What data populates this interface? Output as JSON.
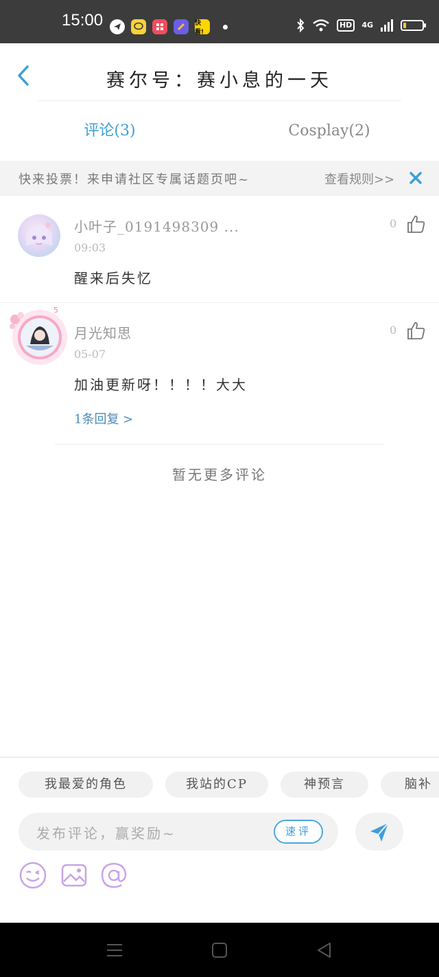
{
  "status_bar": {
    "time": "15:00",
    "app_icons": [
      {
        "name": "messenger-app-icon",
        "color": "#ffffff",
        "label": ""
      },
      {
        "name": "chat-app-icon",
        "color": "#f7d23c",
        "label": ""
      },
      {
        "name": "media-app-icon",
        "color": "#ef4e5e",
        "label": ""
      },
      {
        "name": "notes-app-icon",
        "color": "#6a5fe3",
        "label": ""
      },
      {
        "name": "kuaikan-app-icon",
        "color": "#ffd600",
        "label": "快看!"
      }
    ],
    "hd_label": "HD",
    "network_label": "4G",
    "battery_level": 0.15
  },
  "header": {
    "title": "赛尔号：赛小息的一天"
  },
  "tabs": [
    {
      "label": "评论(3)",
      "active": true
    },
    {
      "label": "Cosplay(2)",
      "active": false
    }
  ],
  "notice": {
    "text": "快来投票！来申请社区专属话题页吧~",
    "rules_link": "查看规则>>"
  },
  "comments": [
    {
      "user": "小叶子_0191498309 ...",
      "time": "09:03",
      "text": "醒来后失忆",
      "likes": "0",
      "reply_link": ""
    },
    {
      "user": "月光知思",
      "time": "05-07",
      "text": "加油更新呀！！！！大大",
      "likes": "0",
      "reply_link": "1条回复 >"
    }
  ],
  "footer_note": "暂无更多评论",
  "composer": {
    "chips": [
      "我最爱的角色",
      "我站的CP",
      "神预言",
      "脑补"
    ],
    "placeholder": "发布评论，赢奖励~",
    "quick_comment_label": "速评"
  },
  "colors": {
    "accent": "#3d9fd8",
    "tool_icon": "#c9a3e8"
  }
}
